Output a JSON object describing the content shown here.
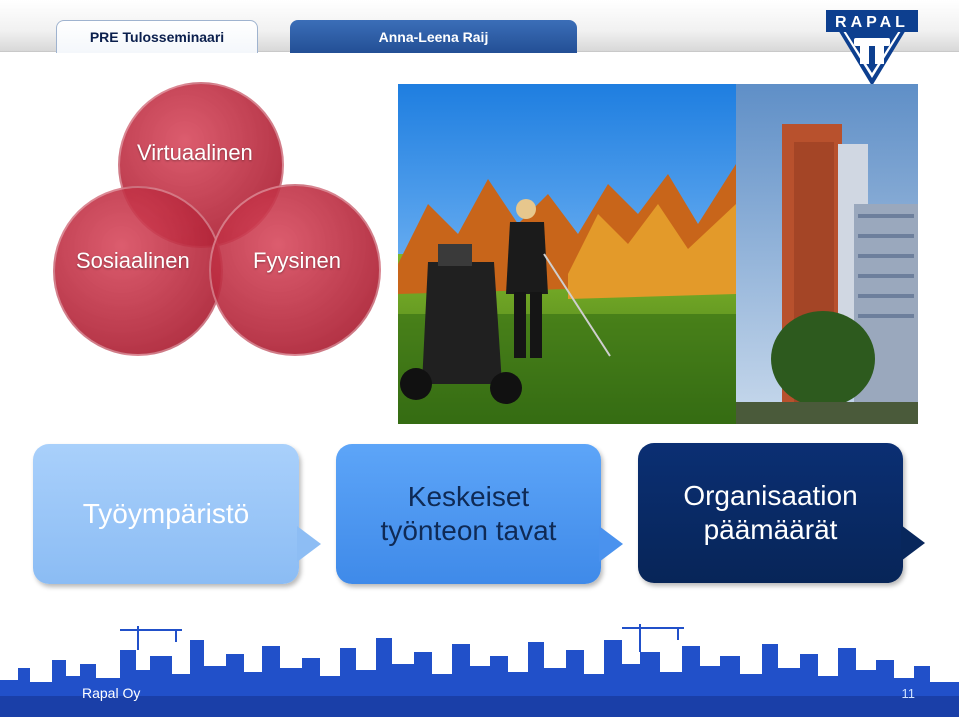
{
  "header": {
    "tab_left_label": "PRE Tulosseminaari",
    "tab_right_label": "Anna-Leena Raij"
  },
  "logo": {
    "text": "RAPAL",
    "icon": "rapal-logo"
  },
  "circles": {
    "virtual_label": "Virtuaalinen",
    "social_label": "Sosiaalinen",
    "physical_label": "Fyysinen",
    "color": "#b3213a"
  },
  "callouts": {
    "work_environment": "Työympäristö",
    "working_methods_line1": "Keskeiset",
    "working_methods_line2": "työnteon tavat",
    "org_goals_line1": "Organisaation",
    "org_goals_line2": "päämäärät",
    "colors": [
      "#9cc7f8",
      "#4b93ef",
      "#082a63"
    ]
  },
  "footer": {
    "company": "Rapal Oy",
    "page_number": "11",
    "skyline_color": "#1f4fc4"
  }
}
